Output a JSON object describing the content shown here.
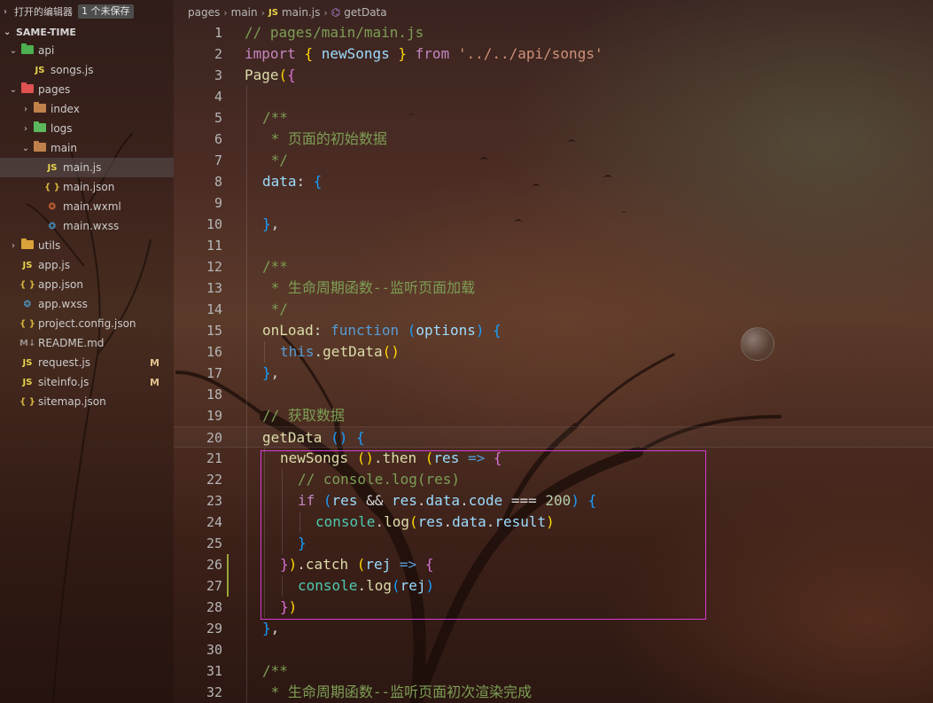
{
  "open_editors": {
    "title": "打开的编辑器",
    "unsaved_badge": "1 个未保存"
  },
  "project": {
    "name": "SAME-TIME"
  },
  "file_tree": [
    {
      "label": "api",
      "kind": "folder",
      "depth": 1,
      "expanded": true,
      "icon": "api-folder-icon",
      "color": "#4caf50"
    },
    {
      "label": "songs.js",
      "kind": "js",
      "depth": 2,
      "icon_text": "JS"
    },
    {
      "label": "pages",
      "kind": "folder",
      "depth": 1,
      "expanded": true,
      "icon": "pages-folder-icon",
      "color": "#e05252"
    },
    {
      "label": "index",
      "kind": "folder",
      "depth": 2,
      "expanded": false,
      "icon": "folder-icon",
      "color": "#c0824a"
    },
    {
      "label": "logs",
      "kind": "folder",
      "depth": 2,
      "expanded": false,
      "icon": "logs-folder-icon",
      "color": "#5cb85c"
    },
    {
      "label": "main",
      "kind": "folder",
      "depth": 2,
      "expanded": true,
      "icon": "folder-open-icon",
      "color": "#c0824a"
    },
    {
      "label": "main.js",
      "kind": "js",
      "depth": 3,
      "icon_text": "JS",
      "selected": true
    },
    {
      "label": "main.json",
      "kind": "json",
      "depth": 3,
      "icon_text": "{ }"
    },
    {
      "label": "main.wxml",
      "kind": "wxml",
      "depth": 3,
      "icon_text": "❂"
    },
    {
      "label": "main.wxss",
      "kind": "wxss",
      "depth": 3,
      "icon_text": "❂"
    },
    {
      "label": "utils",
      "kind": "folder",
      "depth": 1,
      "expanded": false,
      "icon": "utils-folder-icon",
      "color": "#d9a33a"
    },
    {
      "label": "app.js",
      "kind": "js",
      "depth": 1,
      "icon_text": "JS"
    },
    {
      "label": "app.json",
      "kind": "json",
      "depth": 1,
      "icon_text": "{ }"
    },
    {
      "label": "app.wxss",
      "kind": "wxss",
      "depth": 1,
      "icon_text": "❂"
    },
    {
      "label": "project.config.json",
      "kind": "json",
      "depth": 1,
      "icon_text": "{ }"
    },
    {
      "label": "README.md",
      "kind": "md",
      "depth": 1,
      "icon_text": "M↓"
    },
    {
      "label": "request.js",
      "kind": "js",
      "depth": 1,
      "icon_text": "JS",
      "badge": "M"
    },
    {
      "label": "siteinfo.js",
      "kind": "js",
      "depth": 1,
      "icon_text": "JS",
      "badge": "M"
    },
    {
      "label": "sitemap.json",
      "kind": "json",
      "depth": 1,
      "icon_text": "{ }"
    }
  ],
  "breadcrumb": {
    "parts": [
      "pages",
      "main"
    ],
    "file_badge": "JS",
    "file": "main.js",
    "symbol": "getData"
  },
  "code_lines": [
    {
      "n": "1",
      "indent": 0,
      "tokens": [
        [
          "c-comment",
          "// pages/main/main.js"
        ]
      ]
    },
    {
      "n": "2",
      "indent": 0,
      "tokens": [
        [
          "c-keyword",
          "import "
        ],
        [
          "c-br1",
          "{ "
        ],
        [
          "c-var",
          "newSongs"
        ],
        [
          "c-br1",
          " }"
        ],
        [
          "c-keyword",
          " from "
        ],
        [
          "c-string",
          "'../../api/songs'"
        ]
      ]
    },
    {
      "n": "3",
      "indent": 0,
      "tokens": [
        [
          "c-func",
          "Page"
        ],
        [
          "c-br1",
          "("
        ],
        [
          "c-br2",
          "{"
        ]
      ]
    },
    {
      "n": "4",
      "indent": 1,
      "tokens": []
    },
    {
      "n": "5",
      "indent": 1,
      "tokens": [
        [
          "c-comment",
          "/**"
        ]
      ]
    },
    {
      "n": "6",
      "indent": 1,
      "tokens": [
        [
          "c-comment",
          " * 页面的初始数据"
        ]
      ]
    },
    {
      "n": "7",
      "indent": 1,
      "tokens": [
        [
          "c-comment",
          " */"
        ]
      ]
    },
    {
      "n": "8",
      "indent": 1,
      "tokens": [
        [
          "c-var",
          "data"
        ],
        [
          "c-punc",
          ": "
        ],
        [
          "c-br3",
          "{"
        ]
      ]
    },
    {
      "n": "9",
      "indent": 1,
      "tokens": []
    },
    {
      "n": "10",
      "indent": 1,
      "tokens": [
        [
          "c-br3",
          "}"
        ],
        [
          "c-punc",
          ","
        ]
      ]
    },
    {
      "n": "11",
      "indent": 1,
      "tokens": []
    },
    {
      "n": "12",
      "indent": 1,
      "tokens": [
        [
          "c-comment",
          "/**"
        ]
      ]
    },
    {
      "n": "13",
      "indent": 1,
      "tokens": [
        [
          "c-comment",
          " * 生命周期函数--监听页面加载"
        ]
      ]
    },
    {
      "n": "14",
      "indent": 1,
      "tokens": [
        [
          "c-comment",
          " */"
        ]
      ]
    },
    {
      "n": "15",
      "indent": 1,
      "tokens": [
        [
          "c-func",
          "onLoad"
        ],
        [
          "c-punc",
          ": "
        ],
        [
          "c-blue",
          "function"
        ],
        [
          "c-punc",
          " "
        ],
        [
          "c-br3",
          "("
        ],
        [
          "c-var",
          "options"
        ],
        [
          "c-br3",
          ")"
        ],
        [
          "c-punc",
          " "
        ],
        [
          "c-br3",
          "{"
        ]
      ]
    },
    {
      "n": "16",
      "indent": 2,
      "tokens": [
        [
          "c-blue",
          "this"
        ],
        [
          "c-punc",
          "."
        ],
        [
          "c-func",
          "getData"
        ],
        [
          "c-br1",
          "()"
        ]
      ]
    },
    {
      "n": "17",
      "indent": 1,
      "tokens": [
        [
          "c-br3",
          "}"
        ],
        [
          "c-punc",
          ","
        ]
      ]
    },
    {
      "n": "18",
      "indent": 1,
      "tokens": []
    },
    {
      "n": "19",
      "indent": 1,
      "tokens": [
        [
          "c-comment",
          "// 获取数据"
        ]
      ]
    },
    {
      "n": "20",
      "indent": 1,
      "current": true,
      "tokens": [
        [
          "c-func",
          "getData"
        ],
        [
          "c-punc",
          " "
        ],
        [
          "c-br3",
          "()"
        ],
        [
          "c-punc",
          " "
        ],
        [
          "c-br3",
          "{"
        ]
      ]
    },
    {
      "n": "21",
      "indent": 2,
      "tokens": [
        [
          "c-func",
          "newSongs"
        ],
        [
          "c-punc",
          " "
        ],
        [
          "c-br1",
          "()"
        ],
        [
          "c-punc",
          "."
        ],
        [
          "c-func",
          "then"
        ],
        [
          "c-punc",
          " "
        ],
        [
          "c-br1",
          "("
        ],
        [
          "c-var",
          "res"
        ],
        [
          "c-punc",
          " "
        ],
        [
          "c-blue",
          "=>"
        ],
        [
          "c-punc",
          " "
        ],
        [
          "c-br2",
          "{"
        ]
      ]
    },
    {
      "n": "22",
      "indent": 3,
      "tokens": [
        [
          "c-comment",
          "// console.log(res)"
        ]
      ]
    },
    {
      "n": "23",
      "indent": 3,
      "tokens": [
        [
          "c-keyword",
          "if"
        ],
        [
          "c-punc",
          " "
        ],
        [
          "c-br3",
          "("
        ],
        [
          "c-var",
          "res"
        ],
        [
          "c-punc",
          " && "
        ],
        [
          "c-var",
          "res"
        ],
        [
          "c-punc",
          "."
        ],
        [
          "c-var",
          "data"
        ],
        [
          "c-punc",
          "."
        ],
        [
          "c-var",
          "code"
        ],
        [
          "c-punc",
          " === "
        ],
        [
          "c-num",
          "200"
        ],
        [
          "c-br3",
          ")"
        ],
        [
          "c-punc",
          " "
        ],
        [
          "c-br3",
          "{"
        ]
      ]
    },
    {
      "n": "24",
      "indent": 4,
      "tokens": [
        [
          "c-cyan",
          "console"
        ],
        [
          "c-punc",
          "."
        ],
        [
          "c-func",
          "log"
        ],
        [
          "c-br1",
          "("
        ],
        [
          "c-var",
          "res"
        ],
        [
          "c-punc",
          "."
        ],
        [
          "c-var",
          "data"
        ],
        [
          "c-punc",
          "."
        ],
        [
          "c-var",
          "result"
        ],
        [
          "c-br1",
          ")"
        ]
      ]
    },
    {
      "n": "25",
      "indent": 3,
      "tokens": [
        [
          "c-br3",
          "}"
        ]
      ]
    },
    {
      "n": "26",
      "indent": 2,
      "modified": true,
      "tokens": [
        [
          "c-br2",
          "}"
        ],
        [
          "c-br1",
          ")"
        ],
        [
          "c-punc",
          "."
        ],
        [
          "c-func",
          "catch"
        ],
        [
          "c-punc",
          " "
        ],
        [
          "c-br1",
          "("
        ],
        [
          "c-var",
          "rej"
        ],
        [
          "c-punc",
          " "
        ],
        [
          "c-blue",
          "=>"
        ],
        [
          "c-punc",
          " "
        ],
        [
          "c-br2",
          "{"
        ]
      ]
    },
    {
      "n": "27",
      "indent": 3,
      "modified": true,
      "tokens": [
        [
          "c-cyan",
          "console"
        ],
        [
          "c-punc",
          "."
        ],
        [
          "c-func",
          "log"
        ],
        [
          "c-br3",
          "("
        ],
        [
          "c-var",
          "rej"
        ],
        [
          "c-br3",
          ")"
        ]
      ]
    },
    {
      "n": "28",
      "indent": 2,
      "tokens": [
        [
          "c-br2",
          "}"
        ],
        [
          "c-br1",
          ")"
        ]
      ]
    },
    {
      "n": "29",
      "indent": 1,
      "tokens": [
        [
          "c-br3",
          "}"
        ],
        [
          "c-punc",
          ","
        ]
      ]
    },
    {
      "n": "30",
      "indent": 1,
      "tokens": []
    },
    {
      "n": "31",
      "indent": 1,
      "tokens": [
        [
          "c-comment",
          "/**"
        ]
      ]
    },
    {
      "n": "32",
      "indent": 1,
      "tokens": [
        [
          "c-comment",
          " * 生命周期函数--监听页面初次渲染完成"
        ]
      ]
    }
  ]
}
